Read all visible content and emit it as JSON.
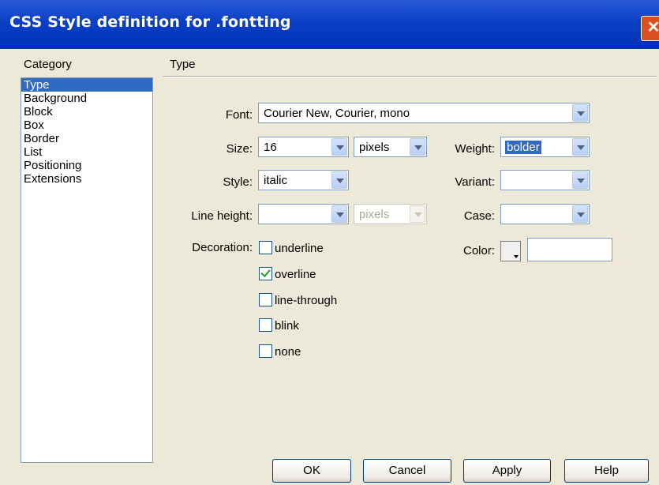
{
  "window": {
    "title": "CSS Style definition for .fontting",
    "close_glyph": "✕"
  },
  "category": {
    "header": "Category",
    "items": [
      "Type",
      "Background",
      "Block",
      "Box",
      "Border",
      "List",
      "Positioning",
      "Extensions"
    ],
    "selected": "Type"
  },
  "panel": {
    "header": "Type",
    "font": {
      "label": "Font:",
      "value": "Courier New, Courier, mono"
    },
    "size": {
      "label": "Size:",
      "value": "16",
      "unit": "pixels"
    },
    "weight": {
      "label": "Weight:",
      "value": "bolder"
    },
    "style": {
      "label": "Style:",
      "value": "italic"
    },
    "variant": {
      "label": "Variant:",
      "value": ""
    },
    "line_height": {
      "label": "Line height:",
      "value": "",
      "unit": "pixels"
    },
    "case": {
      "label": "Case:",
      "value": ""
    },
    "decoration": {
      "label": "Decoration:",
      "options": [
        {
          "label": "underline",
          "checked": false
        },
        {
          "label": "overline",
          "checked": true
        },
        {
          "label": "line-through",
          "checked": false
        },
        {
          "label": "blink",
          "checked": false
        },
        {
          "label": "none",
          "checked": false
        }
      ]
    },
    "color": {
      "label": "Color:",
      "value": ""
    }
  },
  "buttons": {
    "ok": "OK",
    "cancel": "Cancel",
    "apply": "Apply",
    "help": "Help"
  },
  "colors": {
    "title_bar": "#0a3fc4",
    "selection": "#316ac5",
    "dialog_bg": "#ece9d8",
    "close": "#d9501e"
  }
}
